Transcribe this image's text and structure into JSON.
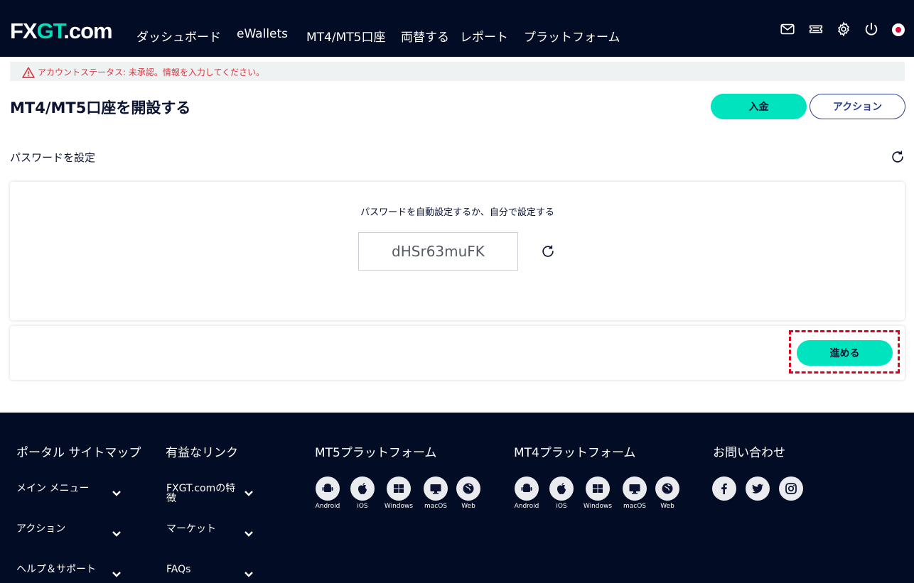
{
  "header": {
    "logo_main": "FX",
    "logo_accent": "GT",
    "logo_tail": ".com",
    "nav": [
      "ダッシュボード",
      "eWallets",
      "MT4/MT5口座",
      "両替する",
      "レポート",
      "プラットフォーム"
    ],
    "icons": [
      "mail-icon",
      "ticket-icon",
      "gear-icon",
      "power-icon",
      "japan-flag-icon"
    ]
  },
  "status": {
    "text": "アカウントステータス: 未承認。情報を入力してください。",
    "color": "#d9363e"
  },
  "page": {
    "title": "MT4/MT5口座を開設する",
    "deposit_label": "入金",
    "action_label": "アクション"
  },
  "password_section": {
    "label": "パスワードを設定",
    "instruction": "パスワードを自動設定するか、自分で設定する",
    "value": "dHSr63muFK",
    "next_label": "進める"
  },
  "footer": {
    "col1": {
      "title": "ポータル サイトマップ",
      "items": [
        "メイン メニュー",
        "アクション",
        "ヘルプ＆サポート"
      ]
    },
    "col2": {
      "title": "有益なリンク",
      "items": [
        "FXGT.comの特徴",
        "マーケット",
        "FAQs"
      ]
    },
    "mt5": {
      "title": "MT5プラットフォーム",
      "apps": [
        "Android",
        "iOS",
        "Windows",
        "macOS",
        "Web"
      ]
    },
    "mt4": {
      "title": "MT4プラットフォーム",
      "apps": [
        "Android",
        "iOS",
        "Windows",
        "macOS",
        "Web"
      ]
    },
    "contact": {
      "title": "お問い合わせ",
      "socials": [
        "facebook-icon",
        "twitter-icon",
        "instagram-icon"
      ]
    }
  },
  "colors": {
    "header_bg": "#020c25",
    "accent": "#00e3bf",
    "action_border": "#2b3f8f",
    "highlight": "#e0001b"
  }
}
